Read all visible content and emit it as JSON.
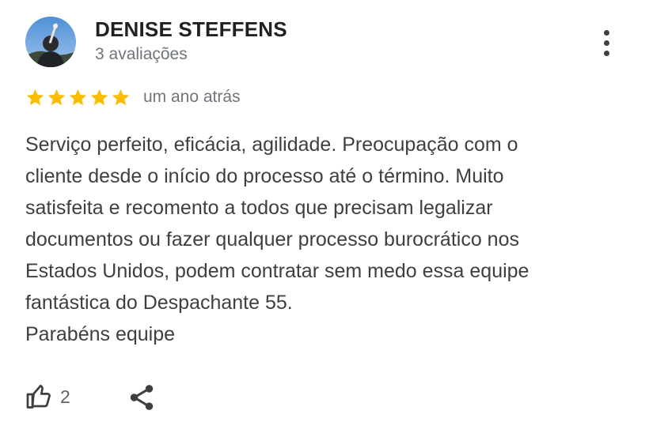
{
  "reviewer": {
    "name": "DENISE STEFFENS",
    "review_count": "3 avaliações",
    "avatar_icon": "user-photo"
  },
  "rating": {
    "stars": 5,
    "max_stars": 5,
    "star_color": "#fbbc04",
    "time_ago": "um ano atrás"
  },
  "review": {
    "lines": [
      "Serviço perfeito, eficácia, agilidade. Preocupação com o",
      "cliente desde o início do processo até o término. Muito",
      "satisfeita e recomento a todos que precisam legalizar",
      "documentos ou fazer qualquer processo burocrático nos",
      "Estados Unidos, podem contratar sem medo essa equipe",
      "fantástica do Despachante 55.",
      "Parabéns equipe"
    ]
  },
  "actions": {
    "like_icon": "thumbs-up-icon",
    "like_count": "2",
    "share_icon": "share-icon",
    "more_icon": "more-vert-icon"
  }
}
